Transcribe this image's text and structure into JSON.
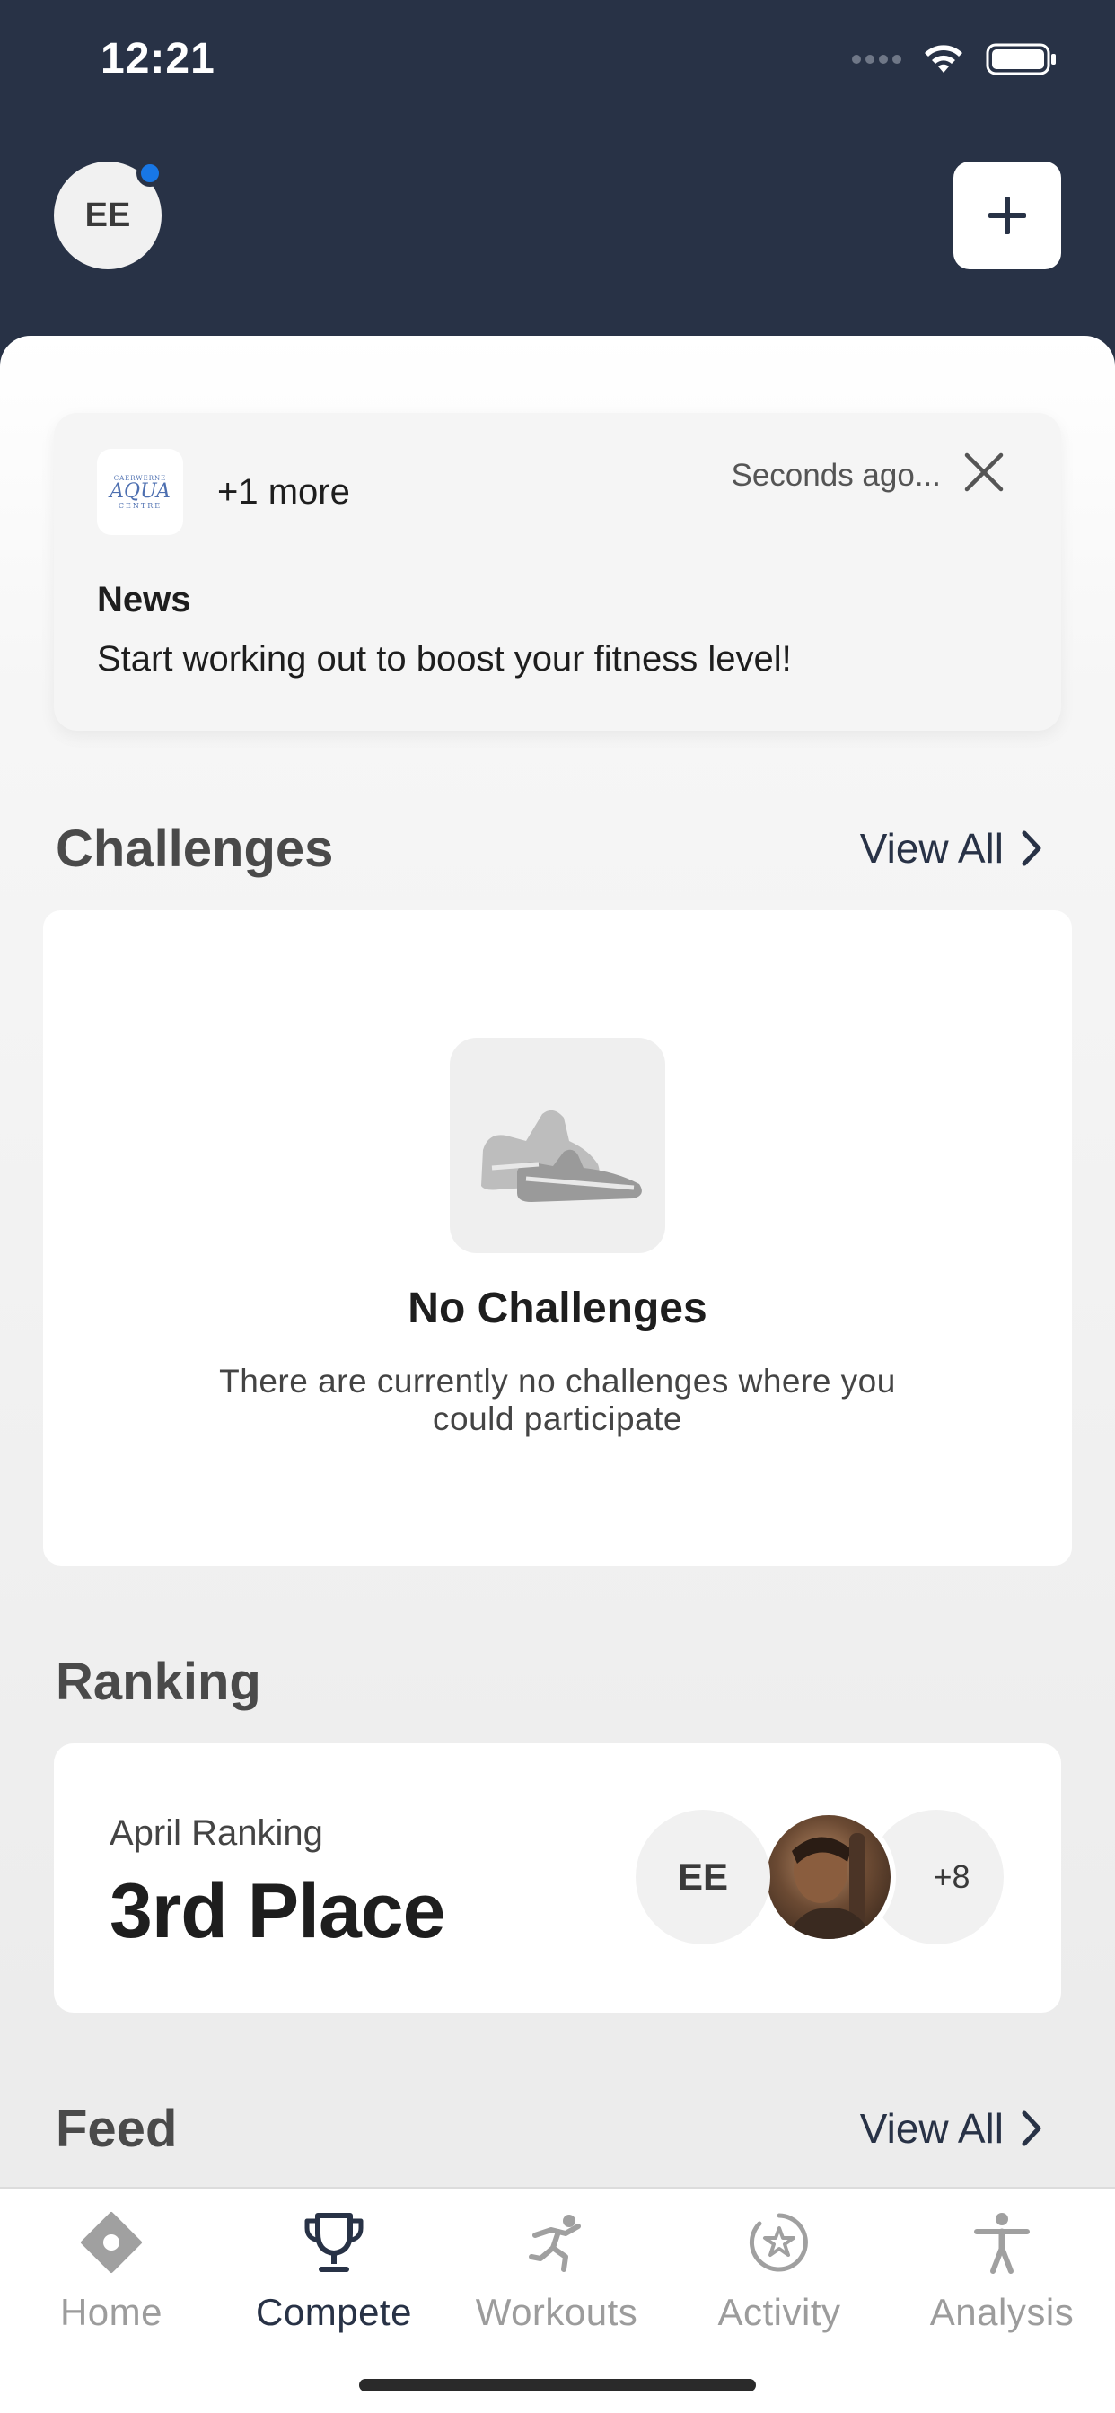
{
  "status_bar": {
    "time": "12:21"
  },
  "header": {
    "avatar_initials": "EE"
  },
  "news": {
    "more_text": "+1 more",
    "time": "Seconds ago...",
    "title": "News",
    "body": "Start working out to boost your fitness level!",
    "logo": {
      "line1": "CAERWERNE",
      "line2": "AQUA",
      "line3": "CENTRE"
    }
  },
  "challenges": {
    "title": "Challenges",
    "view_all": "View All",
    "empty_title": "No Challenges",
    "empty_desc": "There are currently no challenges where you could participate"
  },
  "ranking": {
    "title": "Ranking",
    "label": "April Ranking",
    "place": "3rd Place",
    "avatars": {
      "me": "EE",
      "more": "+8"
    }
  },
  "feed": {
    "title": "Feed",
    "view_all": "View All"
  },
  "tabs": [
    {
      "label": "Home",
      "icon": "home-icon",
      "active": false
    },
    {
      "label": "Compete",
      "icon": "trophy-icon",
      "active": true
    },
    {
      "label": "Workouts",
      "icon": "running-icon",
      "active": false
    },
    {
      "label": "Activity",
      "icon": "activity-star-icon",
      "active": false
    },
    {
      "label": "Analysis",
      "icon": "person-icon",
      "active": false
    }
  ],
  "colors": {
    "header_bg": "#283246",
    "accent_dot": "#1877e6",
    "tab_active": "#283246",
    "tab_inactive": "#9c9c9c"
  }
}
